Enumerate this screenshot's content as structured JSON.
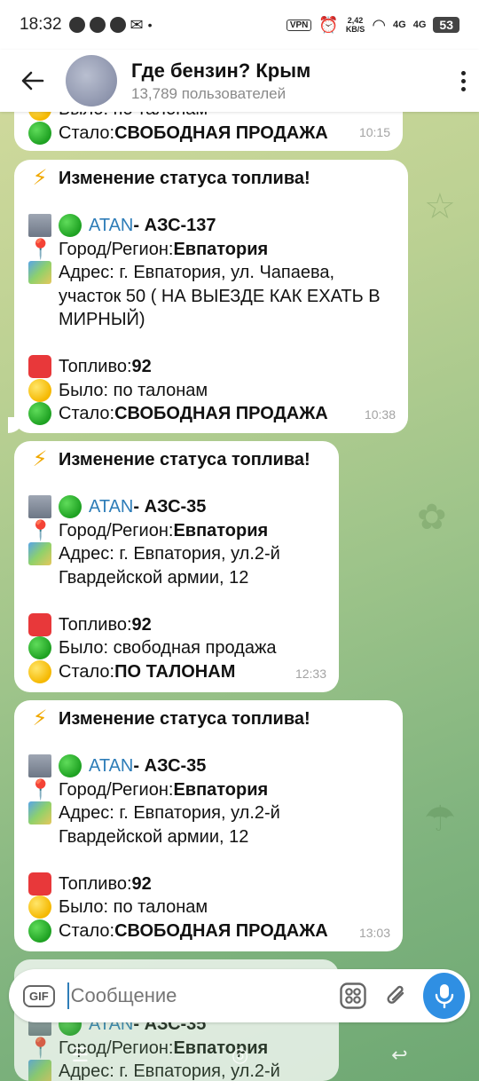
{
  "status_bar": {
    "time": "18:32",
    "vpn": "VPN",
    "speed_value": "2,42",
    "speed_unit": "KB/S",
    "net1": "4G",
    "net2": "4G",
    "battery": "53"
  },
  "header": {
    "title": "Где бензин? Крым",
    "subtitle": "13,789 пользователей"
  },
  "partial_top": {
    "line1_label": "Было: по талонам",
    "line2_label": "Стало: ",
    "line2_value": "СВОБОДНАЯ ПРОДАЖА",
    "time": "10:15"
  },
  "messages": [
    {
      "heading": "Изменение статуса топлива!",
      "brand": "ATAN",
      "station": " - АЗС-137",
      "city_label": "Город/Регион: ",
      "city": "Евпатория",
      "address": "Адрес: г. Евпатория, ул. Чапаева, участок 50 ( НА ВЫЕЗДЕ КАК ЕХАТЬ В МИРНЫЙ)",
      "fuel_label": "Топливо: ",
      "fuel": "92",
      "was": "Было: по талонам",
      "now_label": "Стало: ",
      "now": "СВОБОДНАЯ ПРОДАЖА",
      "time": "10:38"
    },
    {
      "heading": "Изменение статуса топлива!",
      "brand": "ATAN",
      "station": " - АЗС-35",
      "city_label": "Город/Регион: ",
      "city": "Евпатория",
      "address": "Адрес: г. Евпатория, ул.2-й Гвардейской армии, 12",
      "fuel_label": "Топливо: ",
      "fuel": "92",
      "was": "Было: свободная продажа",
      "now_label": "Стало: ",
      "now": "ПО ТАЛОНАМ",
      "time": "12:33"
    },
    {
      "heading": "Изменение статуса топлива!",
      "brand": "ATAN",
      "station": " - АЗС-35",
      "city_label": "Город/Регион: ",
      "city": "Евпатория",
      "address": "Адрес: г. Евпатория, ул.2-й Гвардейской армии, 12",
      "fuel_label": "Топливо: ",
      "fuel": "92",
      "was": "Было: по талонам",
      "now_label": "Стало: ",
      "now": "СВОБОДНАЯ ПРОДАЖА",
      "time": "13:03"
    }
  ],
  "partial_bottom": {
    "brand": "ATAN",
    "station": " - АЗС-35",
    "city_label": "Город/Регион: ",
    "city": "Евпатория",
    "address": "Адрес: г. Евпатория, ул.2-й"
  },
  "composer": {
    "gif_label": "GIF",
    "placeholder": "Сообщение"
  }
}
